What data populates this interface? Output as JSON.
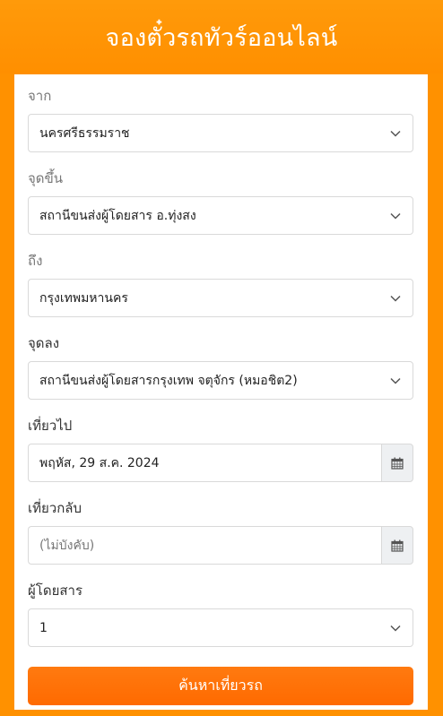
{
  "header": {
    "title": "จองตั๋วรถทัวร์ออนไลน์"
  },
  "form": {
    "from": {
      "label": "จาก",
      "value": "นครศรีธรรมราช"
    },
    "boarding": {
      "label": "จุดขึ้น",
      "value": "สถานีขนส่งผู้โดยสาร อ.ทุ่งสง"
    },
    "to": {
      "label": "ถึง",
      "value": "กรุงเทพมหานคร"
    },
    "dropoff": {
      "label": "จุดลง",
      "value": "สถานีขนส่งผู้โดยสารกรุงเทพ จตุจักร (หมอชิต2)"
    },
    "depart": {
      "label": "เที่ยวไป",
      "value": "พฤหัส, 29 ส.ค. 2024"
    },
    "return": {
      "label": "เที่ยวกลับ",
      "placeholder": "(ไม่บังคับ)"
    },
    "passengers": {
      "label": "ผู้โดยสาร",
      "value": "1"
    },
    "search_label": "ค้นหาเที่ยวรถ"
  },
  "icons": {
    "dropdown": "chevron-down-icon",
    "calendar": "calendar-icon"
  },
  "colors": {
    "brand": "#ff9100",
    "button": "#ff6a00"
  }
}
